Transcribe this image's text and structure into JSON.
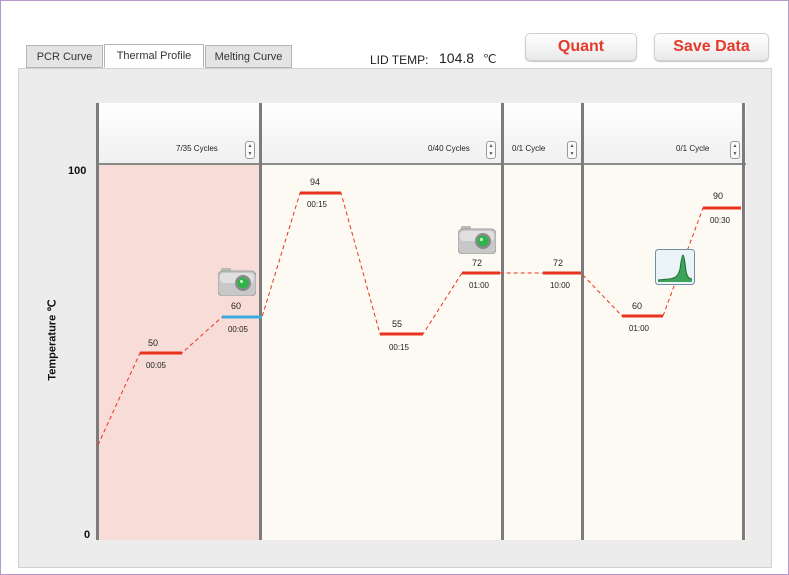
{
  "tabs": [
    {
      "label": "PCR Curve",
      "active": false
    },
    {
      "label": "Thermal Profile",
      "active": true
    },
    {
      "label": "Melting Curve",
      "active": false
    }
  ],
  "lid_temp": {
    "label": "LID TEMP:",
    "value": "104.8",
    "unit": "℃"
  },
  "buttons": {
    "quant": "Quant",
    "save": "Save Data"
  },
  "y_axis": {
    "label": "Temperature ℃",
    "max_label": "100",
    "min_label": "0"
  },
  "stages": [
    {
      "cycles": "7/35 Cycles",
      "highlight": true
    },
    {
      "cycles": "0/40 Cycles",
      "highlight": false
    },
    {
      "cycles": "0/1 Cycle",
      "highlight": false
    },
    {
      "cycles": "0/1 Cycle",
      "highlight": false
    }
  ],
  "steps": [
    {
      "temp": "50",
      "time": "00:05",
      "color": "#e8321e"
    },
    {
      "temp": "60",
      "time": "00:05",
      "color": "#3aa9e0"
    },
    {
      "temp": "94",
      "time": "00:15",
      "color": "#e8321e"
    },
    {
      "temp": "55",
      "time": "00:15",
      "color": "#e8321e"
    },
    {
      "temp": "72",
      "time": "01:00",
      "color": "#e8321e"
    },
    {
      "temp": "72",
      "time": "10:00",
      "color": "#e8321e"
    },
    {
      "temp": "60",
      "time": "01:00",
      "color": "#e8321e"
    },
    {
      "temp": "90",
      "time": "00:30",
      "color": "#e8321e"
    }
  ],
  "icons": {
    "camera": "camera-icon",
    "melt_curve": "melt-curve-icon"
  },
  "colors": {
    "accent": "#e53a2a",
    "active_stage": "#f8dcd7",
    "stage_bg": "#fcfaf2",
    "line": "#e8321e"
  }
}
